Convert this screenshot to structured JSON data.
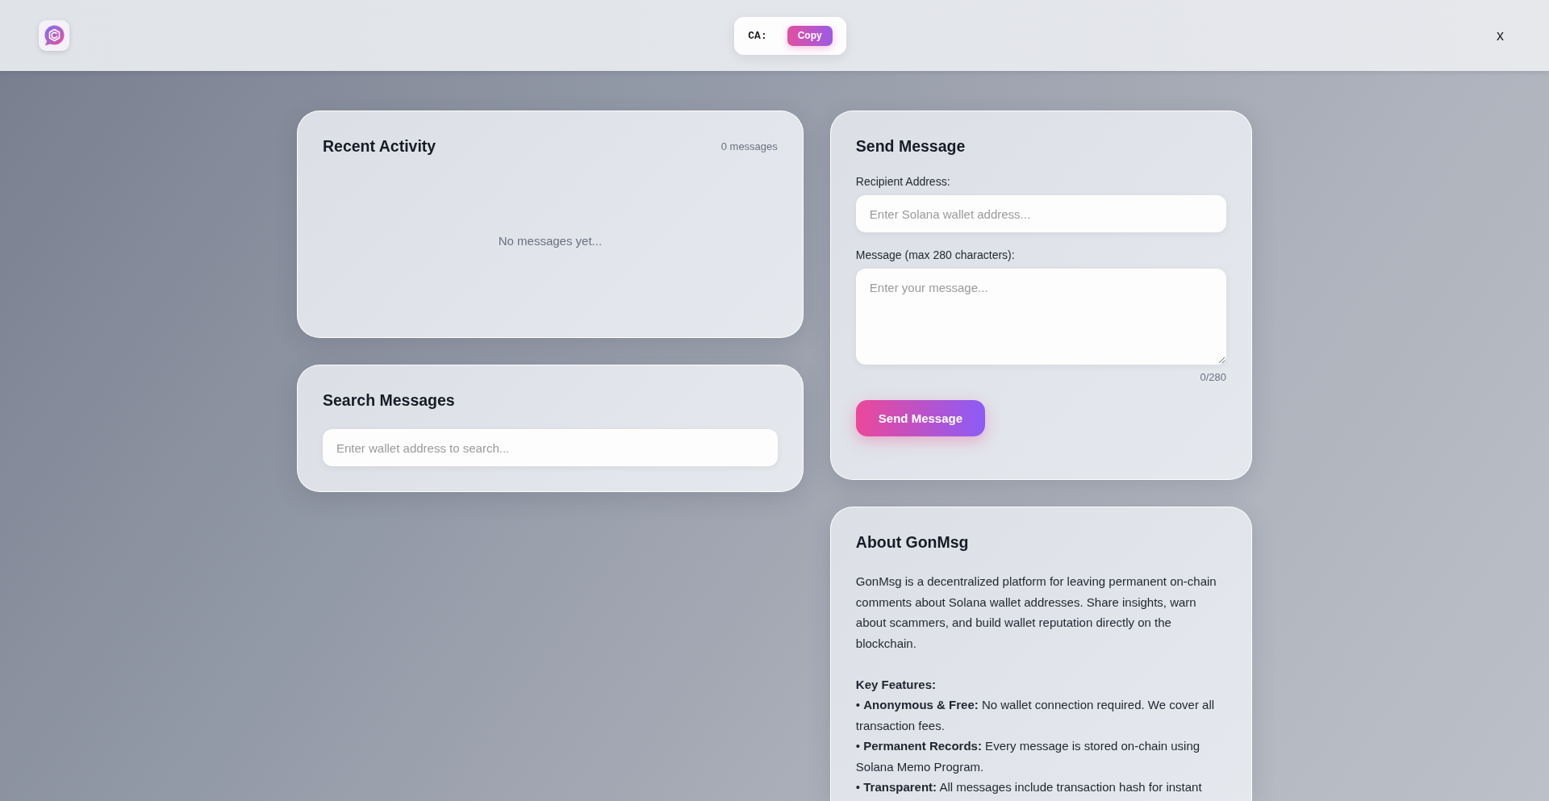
{
  "header": {
    "ca_label": "CA:",
    "copy_button": "Copy",
    "close_button": "x"
  },
  "recent_activity": {
    "title": "Recent Activity",
    "count": "0 messages",
    "empty_text": "No messages yet..."
  },
  "search": {
    "title": "Search Messages",
    "field": {
      "placeholder": "Enter wallet address to search..."
    }
  },
  "send_message": {
    "title": "Send Message",
    "recipient": {
      "label": "Recipient Address:",
      "placeholder": "Enter Solana wallet address..."
    },
    "message": {
      "label": "Message (max 280 characters):",
      "placeholder": "Enter your message...",
      "counter": "0/280"
    },
    "button": "Send Message"
  },
  "about": {
    "title": "About GonMsg",
    "intro": "GonMsg is a decentralized platform for leaving permanent on-chain comments about Solana wallet addresses. Share insights, warn about scammers, and build wallet reputation directly on the blockchain.",
    "features_title": "Key Features:",
    "features": [
      "• **Anonymous & Free:** No wallet connection required. We cover all transaction fees.",
      "• **Permanent Records:** Every message is stored on-chain using Solana Memo Program.",
      "• **Transparent:** All messages include transaction hash for instant"
    ]
  }
}
